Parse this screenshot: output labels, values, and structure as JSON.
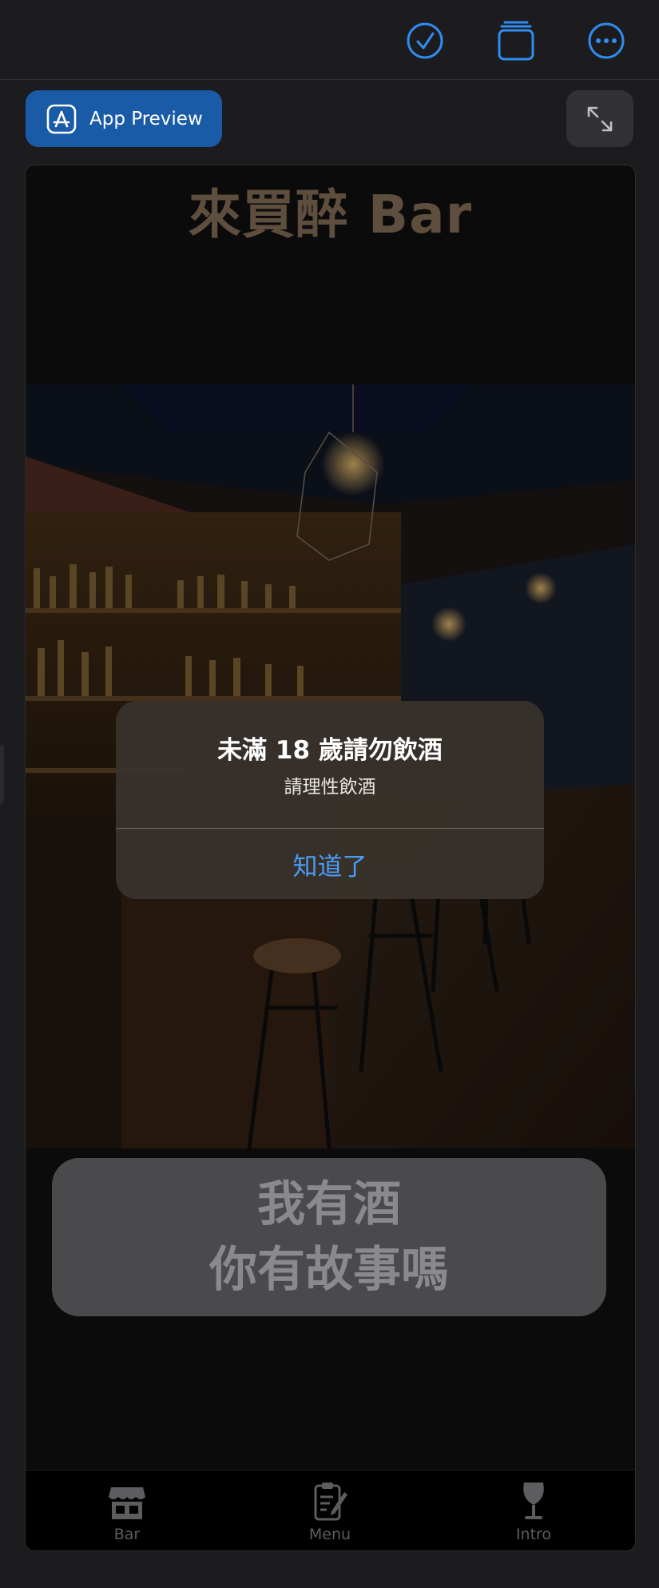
{
  "toolbar": {
    "icons": [
      "checkmark-circle-icon",
      "stacked-windows-icon",
      "ellipsis-circle-icon"
    ],
    "accent_color": "#2f8cf0"
  },
  "preview": {
    "button_label": "App Preview",
    "button_icon": "app-store-icon",
    "button_color": "#1a5ba8",
    "expand_icon": "expand-arrows-icon"
  },
  "app": {
    "title": "來買醉 Bar",
    "title_color": "#5e4e3d",
    "photo": "bar-interior-photo",
    "quote_lines": [
      "我有酒",
      "你有故事嗎"
    ],
    "tabs": [
      {
        "label": "Bar",
        "icon": "storefront-icon"
      },
      {
        "label": "Menu",
        "icon": "clipboard-pencil-icon"
      },
      {
        "label": "Intro",
        "icon": "wineglass-icon"
      }
    ]
  },
  "alert": {
    "title": "未滿 18 歲請勿飲酒",
    "message": "請理性飲酒",
    "button": "知道了",
    "button_color": "#4a9cf6"
  }
}
